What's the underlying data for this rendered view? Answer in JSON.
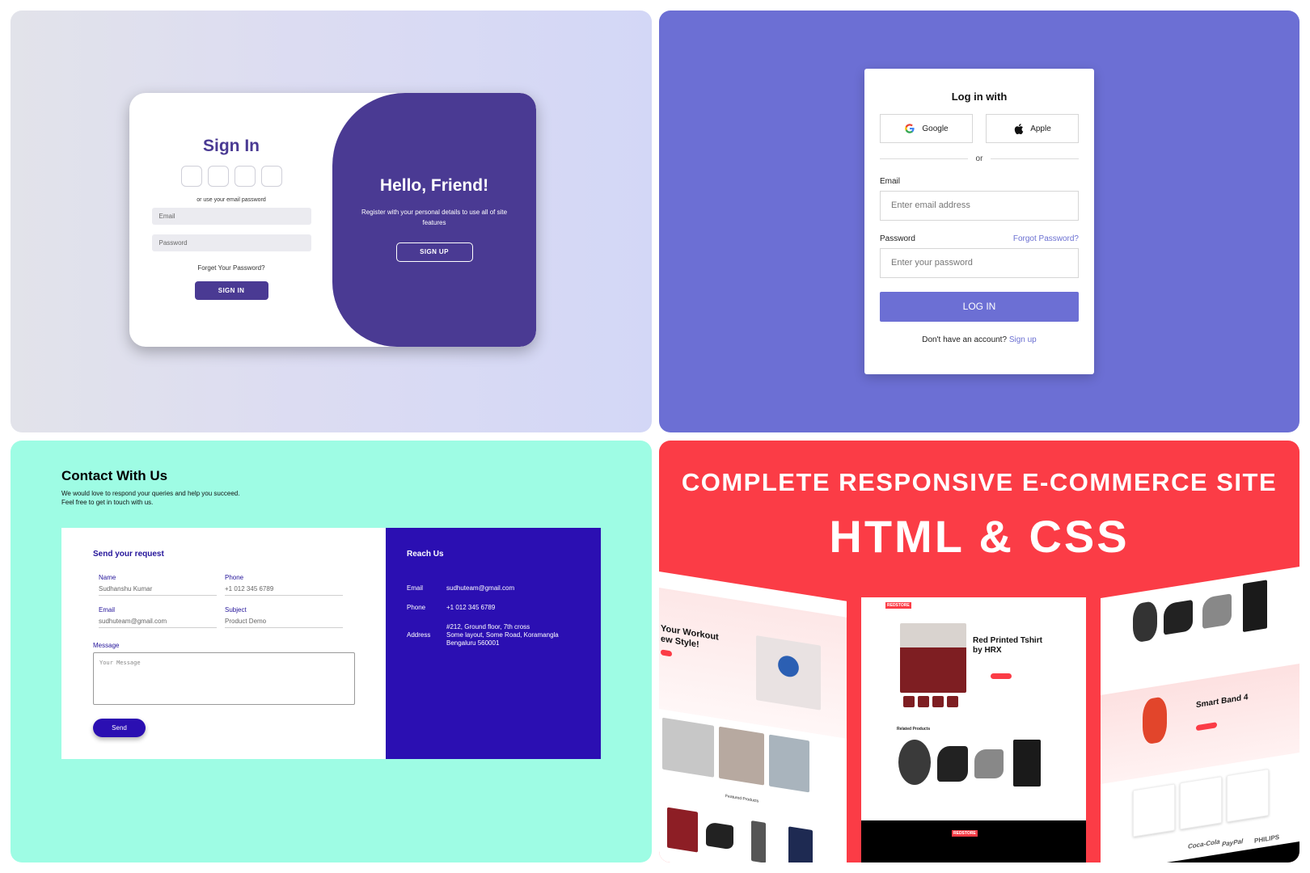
{
  "signin_panel": {
    "title": "Sign In",
    "alt_text": "or use your email password",
    "email_placeholder": "Email",
    "password_placeholder": "Password",
    "forgot_link": "Forget Your Password?",
    "signin_button": "SIGN IN",
    "overlay_title": "Hello, Friend!",
    "overlay_text": "Register with your personal details to use all of site features",
    "signup_button": "SIGN UP",
    "colors": {
      "primary": "#4a3a93"
    }
  },
  "login_panel": {
    "title": "Log in with",
    "google_label": "Google",
    "apple_label": "Apple",
    "divider": "or",
    "email_label": "Email",
    "email_placeholder": "Enter email address",
    "password_label": "Password",
    "forgot_link": "Forgot Password?",
    "password_placeholder": "Enter your password",
    "login_button": "LOG IN",
    "no_account": "Don't have an account?",
    "signup_link": "Sign up",
    "colors": {
      "primary": "#6c6fd4"
    }
  },
  "contact_panel": {
    "title": "Contact With Us",
    "subtitle_line1": "We would love to respond your queries and help you succeed.",
    "subtitle_line2": "Feel free to get in touch with us.",
    "form_title": "Send your request",
    "fields": {
      "name_label": "Name",
      "name_value": "Sudhanshu Kumar",
      "phone_label": "Phone",
      "phone_value": "+1 012 345 6789",
      "email_label": "Email",
      "email_value": "sudhuteam@gmail.com",
      "subject_label": "Subject",
      "subject_value": "Product Demo"
    },
    "message_label": "Message",
    "message_placeholder": "Your Message",
    "send_button": "Send",
    "reach_title": "Reach Us",
    "reach": {
      "email_key": "Email",
      "email_value": "sudhuteam@gmail.com",
      "phone_key": "Phone",
      "phone_value": "+1 012 345 6789",
      "address_key": "Address",
      "address_line1": "#212, Ground floor, 7th cross",
      "address_line2": "Some layout, Some Road, Koramangla",
      "address_line3": "Bengaluru 560001"
    },
    "colors": {
      "background": "#9efce4",
      "accent": "#2b0fb2"
    }
  },
  "ecommerce_panel": {
    "headline": "COMPLETE RESPONSIVE E-COMMERCE SITE",
    "subheadline": "HTML & CSS",
    "left_mock": {
      "hero_line1": "Your Workout",
      "hero_line2": "ew Style!",
      "section": "Featured Products"
    },
    "center_mock": {
      "logo": "REDSTORE",
      "product_line1": "Red Printed Tshirt",
      "product_line2": "by HRX",
      "section": "Related Products"
    },
    "right_mock": {
      "product": "Smart Band 4",
      "brands": [
        "Coca-Cola",
        "PayPal",
        "PHILIPS"
      ]
    },
    "colors": {
      "background": "#fb3c46"
    }
  }
}
